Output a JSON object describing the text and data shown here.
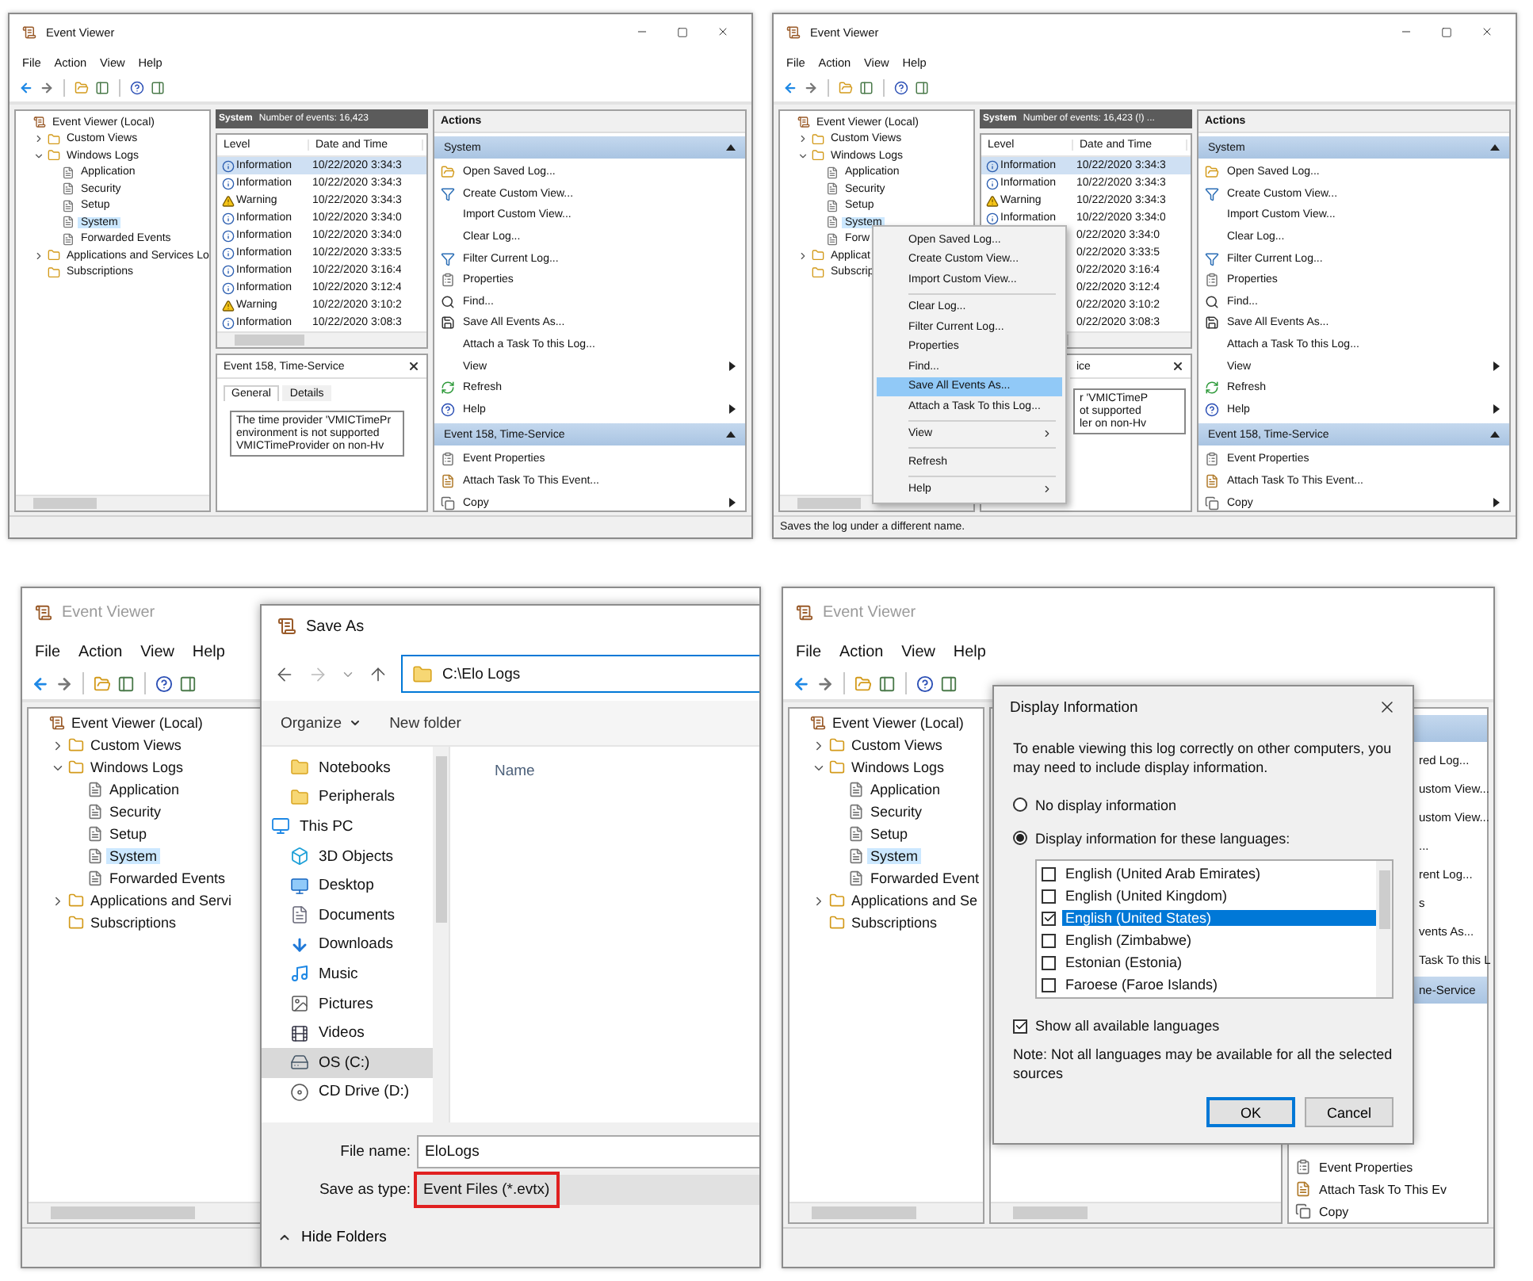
{
  "panels": [
    {
      "kind": "event-viewer",
      "window": {
        "title": "Event Viewer",
        "active": true
      },
      "menu": [
        "File",
        "Action",
        "View",
        "Help"
      ],
      "tree": [
        {
          "label": "Event Viewer (Local)",
          "kind": "root",
          "selected": false,
          "children": [
            {
              "label": "Custom Views",
              "kind": "folder",
              "expanded": false,
              "selected": false
            },
            {
              "label": "Windows Logs",
              "kind": "folder",
              "expanded": true,
              "selected": false,
              "children": [
                {
                  "label": "Application",
                  "kind": "log",
                  "selected": false
                },
                {
                  "label": "Security",
                  "kind": "log",
                  "selected": false
                },
                {
                  "label": "Setup",
                  "kind": "log",
                  "selected": false
                },
                {
                  "label": "System",
                  "kind": "log",
                  "selected": true
                },
                {
                  "label": "Forwarded Events",
                  "kind": "log",
                  "selected": false
                }
              ]
            },
            {
              "label": "Applications and Services Lo",
              "kind": "folder",
              "expanded": false,
              "selected": false
            },
            {
              "label": "Subscriptions",
              "kind": "folder",
              "selected": false
            }
          ]
        }
      ],
      "events_header": {
        "title": "System",
        "info": "Number of events: 16,423"
      },
      "events": {
        "columns": [
          "Level",
          "Date and Time"
        ],
        "rows": [
          {
            "kind": "information",
            "level": "Information",
            "date": "10/22/2020 3:34:3",
            "selected": true
          },
          {
            "kind": "information",
            "level": "Information",
            "date": "10/22/2020 3:34:3",
            "selected": false
          },
          {
            "kind": "warning",
            "level": "Warning",
            "date": "10/22/2020 3:34:3",
            "selected": false
          },
          {
            "kind": "information",
            "level": "Information",
            "date": "10/22/2020 3:34:0",
            "selected": false
          },
          {
            "kind": "information",
            "level": "Information",
            "date": "10/22/2020 3:34:0",
            "selected": false
          },
          {
            "kind": "information",
            "level": "Information",
            "date": "10/22/2020 3:33:5",
            "selected": false
          },
          {
            "kind": "information",
            "level": "Information",
            "date": "10/22/2020 3:16:4",
            "selected": false
          },
          {
            "kind": "information",
            "level": "Information",
            "date": "10/22/2020 3:12:4",
            "selected": false
          },
          {
            "kind": "warning",
            "level": "Warning",
            "date": "10/22/2020 3:10:2",
            "selected": false
          },
          {
            "kind": "information",
            "level": "Information",
            "date": "10/22/2020 3:08:3",
            "selected": false
          }
        ]
      },
      "detail": {
        "title": "Event 158, Time-Service",
        "tabs": [
          {
            "label": "General",
            "selected": true
          },
          {
            "label": "Details",
            "selected": false
          }
        ],
        "lines": [
          "The time provider 'VMICTimePr",
          "environment is not supported",
          "VMICTimeProvider on non-Hv"
        ]
      },
      "actions": {
        "title": "Actions",
        "sections": [
          {
            "title": "System",
            "items": [
              {
                "label": "Open Saved Log...",
                "kind": "open"
              },
              {
                "label": "Create Custom View...",
                "kind": "filter"
              },
              {
                "label": "Import Custom View...",
                "kind": "plain"
              },
              {
                "label": "Clear Log...",
                "kind": "plain"
              },
              {
                "label": "Filter Current Log...",
                "kind": "filter"
              },
              {
                "label": "Properties",
                "kind": "properties"
              },
              {
                "label": "Find...",
                "kind": "find"
              },
              {
                "label": "Save All Events As...",
                "kind": "save"
              },
              {
                "label": "Attach a Task To this Log...",
                "kind": "plain"
              },
              {
                "label": "View",
                "kind": "plain",
                "submenu": true
              },
              {
                "label": "Refresh",
                "kind": "refresh"
              },
              {
                "label": "Help",
                "kind": "help",
                "submenu": true
              }
            ]
          },
          {
            "title": "Event 158, Time-Service",
            "items": [
              {
                "label": "Event Properties",
                "kind": "properties"
              },
              {
                "label": "Attach Task To This Event...",
                "kind": "task"
              },
              {
                "label": "Copy",
                "kind": "copy",
                "submenu": true
              }
            ]
          }
        ]
      }
    },
    {
      "kind": "event-viewer-menu",
      "window": {
        "title": "Event Viewer",
        "active": true
      },
      "menu": [
        "File",
        "Action",
        "View",
        "Help"
      ],
      "tree": [
        {
          "label": "Event Viewer (Local)",
          "kind": "root",
          "selected": false,
          "children": [
            {
              "label": "Custom Views",
              "kind": "folder",
              "expanded": false,
              "selected": false
            },
            {
              "label": "Windows Logs",
              "kind": "folder",
              "expanded": true,
              "selected": false,
              "children": [
                {
                  "label": "Application",
                  "kind": "log",
                  "selected": false
                },
                {
                  "label": "Security",
                  "kind": "log",
                  "selected": false
                },
                {
                  "label": "Setup",
                  "kind": "log",
                  "selected": false
                },
                {
                  "label": "System",
                  "kind": "log",
                  "selected": true
                },
                {
                  "label": "Forw",
                  "kind": "log",
                  "selected": false
                }
              ]
            },
            {
              "label": "Applicat",
              "kind": "folder",
              "expanded": false,
              "selected": false
            },
            {
              "label": "Subscrip",
              "kind": "folder",
              "selected": false
            }
          ]
        }
      ],
      "events_header": {
        "title": "System",
        "info": "Number of events: 16,423 (!) ..."
      },
      "events": {
        "columns": [
          "Level",
          "Date and Time"
        ],
        "rows": [
          {
            "kind": "information",
            "level": "Information",
            "date": "10/22/2020 3:34:3",
            "selected": true
          },
          {
            "kind": "information",
            "level": "Information",
            "date": "10/22/2020 3:34:3",
            "selected": false
          },
          {
            "kind": "warning",
            "level": "Warning",
            "date": "10/22/2020 3:34:3",
            "selected": false
          },
          {
            "kind": "information",
            "level": "Information",
            "date": "10/22/2020 3:34:0",
            "selected": false
          },
          {
            "kind": "covered",
            "date": "0/22/2020 3:34:0",
            "selected": false
          },
          {
            "kind": "covered",
            "date": "0/22/2020 3:33:5",
            "selected": false
          },
          {
            "kind": "covered",
            "date": "0/22/2020 3:16:4",
            "selected": false
          },
          {
            "kind": "covered",
            "date": "0/22/2020 3:12:4",
            "selected": false
          },
          {
            "kind": "covered",
            "date": "0/22/2020 3:10:2",
            "selected": false
          },
          {
            "kind": "covered",
            "date": "0/22/2020 3:08:3",
            "selected": false
          }
        ]
      },
      "detail": {
        "title": "ice",
        "lines": [
          "r 'VMICTimeP",
          "ot supported",
          "ler on non-Hv"
        ]
      },
      "actions": {
        "title": "Actions",
        "sections": [
          {
            "title": "System",
            "items": [
              {
                "label": "Open Saved Log...",
                "kind": "open"
              },
              {
                "label": "Create Custom View...",
                "kind": "filter"
              },
              {
                "label": "Import Custom View...",
                "kind": "plain"
              },
              {
                "label": "Clear Log...",
                "kind": "plain"
              },
              {
                "label": "Filter Current Log...",
                "kind": "filter"
              },
              {
                "label": "Properties",
                "kind": "properties"
              },
              {
                "label": "Find...",
                "kind": "find"
              },
              {
                "label": "Save All Events As...",
                "kind": "save"
              },
              {
                "label": "Attach a Task To this Log...",
                "kind": "plain"
              },
              {
                "label": "View",
                "kind": "plain",
                "submenu": true
              },
              {
                "label": "Refresh",
                "kind": "refresh"
              },
              {
                "label": "Help",
                "kind": "help",
                "submenu": true
              }
            ]
          },
          {
            "title": "Event 158, Time-Service",
            "items": [
              {
                "label": "Event Properties",
                "kind": "properties"
              },
              {
                "label": "Attach Task To This Event...",
                "kind": "task"
              },
              {
                "label": "Copy",
                "kind": "copy",
                "submenu": true
              }
            ]
          }
        ]
      },
      "context_menu": [
        {
          "kind": "item",
          "label": "Open Saved Log...",
          "selected": false
        },
        {
          "kind": "item",
          "label": "Create Custom View...",
          "selected": false
        },
        {
          "kind": "item",
          "label": "Import Custom View...",
          "selected": false
        },
        {
          "kind": "separator"
        },
        {
          "kind": "item",
          "label": "Clear Log...",
          "selected": false
        },
        {
          "kind": "item",
          "label": "Filter Current Log...",
          "selected": false
        },
        {
          "kind": "item",
          "label": "Properties",
          "selected": false
        },
        {
          "kind": "item",
          "label": "Find...",
          "selected": false
        },
        {
          "kind": "item",
          "label": "Save All Events As...",
          "selected": true
        },
        {
          "kind": "item",
          "label": "Attach a Task To this Log...",
          "selected": false
        },
        {
          "kind": "separator"
        },
        {
          "kind": "item",
          "label": "View",
          "selected": false,
          "submenu": true
        },
        {
          "kind": "separator"
        },
        {
          "kind": "item",
          "label": "Refresh",
          "selected": false
        },
        {
          "kind": "separator"
        },
        {
          "kind": "item",
          "label": "Help",
          "selected": false,
          "submenu": true
        }
      ],
      "status": "Saves the log under a different name."
    },
    {
      "kind": "save-as",
      "window": {
        "title": "Event Viewer",
        "active": false
      },
      "menu": [
        "File",
        "Action",
        "View",
        "Help"
      ],
      "tree": [
        {
          "label": "Event Viewer (Local)",
          "kind": "root",
          "selected": false,
          "children": [
            {
              "label": "Custom Views",
              "kind": "folder",
              "expanded": false,
              "selected": false
            },
            {
              "label": "Windows Logs",
              "kind": "folder",
              "expanded": true,
              "selected": false,
              "children": [
                {
                  "label": "Application",
                  "kind": "log",
                  "selected": false
                },
                {
                  "label": "Security",
                  "kind": "log",
                  "selected": false
                },
                {
                  "label": "Setup",
                  "kind": "log",
                  "selected": false
                },
                {
                  "label": "System",
                  "kind": "log",
                  "selected": true
                },
                {
                  "label": "Forwarded Events",
                  "kind": "log",
                  "selected": false
                }
              ]
            },
            {
              "label": "Applications and Servi",
              "kind": "folder",
              "expanded": false,
              "selected": false
            },
            {
              "label": "Subscriptions",
              "kind": "folder",
              "selected": false
            }
          ]
        }
      ],
      "dialog": {
        "title": "Save As",
        "address": "C:\\Elo Logs",
        "toolbar": [
          {
            "label": "Organize",
            "dropdown": true
          },
          {
            "label": "New folder",
            "dropdown": false
          }
        ],
        "nav": [
          {
            "label": "Notebooks",
            "kind": "folder",
            "selected": false
          },
          {
            "label": "Peripherals",
            "kind": "folder",
            "selected": false
          },
          {
            "label": "This PC",
            "kind": "pc",
            "selected": false
          },
          {
            "label": "3D Objects",
            "kind": "objects",
            "selected": false
          },
          {
            "label": "Desktop",
            "kind": "desktop",
            "selected": false
          },
          {
            "label": "Documents",
            "kind": "documents",
            "selected": false
          },
          {
            "label": "Downloads",
            "kind": "downloads",
            "selected": false
          },
          {
            "label": "Music",
            "kind": "music",
            "selected": false
          },
          {
            "label": "Pictures",
            "kind": "pictures",
            "selected": false
          },
          {
            "label": "Videos",
            "kind": "videos",
            "selected": false
          },
          {
            "label": "OS (C:)",
            "kind": "drive",
            "selected": true
          },
          {
            "label": "CD Drive (D:)",
            "kind": "cd",
            "selected": false
          }
        ],
        "columns": [
          "Name"
        ],
        "file_name": {
          "label": "File name:",
          "value": "EloLogs"
        },
        "save_type": {
          "label": "Save as type:",
          "value": "Event Files (*.evtx)",
          "highlighted": true
        },
        "hide_folders": "Hide Folders"
      }
    },
    {
      "kind": "display-info",
      "window": {
        "title": "Event Viewer",
        "active": false
      },
      "menu": [
        "File",
        "Action",
        "View",
        "Help"
      ],
      "tree": [
        {
          "label": "Event Viewer (Local)",
          "kind": "root",
          "selected": false,
          "children": [
            {
              "label": "Custom Views",
              "kind": "folder",
              "expanded": false,
              "selected": false
            },
            {
              "label": "Windows Logs",
              "kind": "folder",
              "expanded": true,
              "selected": false,
              "children": [
                {
                  "label": "Application",
                  "kind": "log",
                  "selected": false
                },
                {
                  "label": "Security",
                  "kind": "log",
                  "selected": false
                },
                {
                  "label": "Setup",
                  "kind": "log",
                  "selected": false
                },
                {
                  "label": "System",
                  "kind": "log",
                  "selected": true
                },
                {
                  "label": "Forwarded Event",
                  "kind": "log",
                  "selected": false
                }
              ]
            },
            {
              "label": "Applications and Se",
              "kind": "folder",
              "expanded": false,
              "selected": false
            },
            {
              "label": "Subscriptions",
              "kind": "folder",
              "selected": false
            }
          ]
        }
      ],
      "actions": [
        {
          "kind": "section"
        },
        {
          "kind": "fragment",
          "label": "red Log..."
        },
        {
          "kind": "fragment",
          "label": "ustom View..."
        },
        {
          "kind": "fragment",
          "label": "ustom View..."
        },
        {
          "kind": "fragment",
          "label": "..."
        },
        {
          "kind": "fragment",
          "label": "rent Log..."
        },
        {
          "kind": "fragment",
          "label": "s"
        },
        {
          "kind": "fragment",
          "label": "vents As..."
        },
        {
          "kind": "fragment",
          "label": "Task To this L"
        },
        {
          "kind": "section",
          "label": "ne-Service"
        },
        {
          "kind": "properties",
          "label": "Event Properties"
        },
        {
          "kind": "task",
          "label": "Attach Task To This Ev"
        },
        {
          "kind": "copy",
          "label": "Copy"
        }
      ],
      "dialog": {
        "title": "Display Information",
        "message": "To enable viewing this log correctly on other computers, you may need to include display information.",
        "options": [
          {
            "label": "No display information",
            "selected": false
          },
          {
            "label": "Display information for these languages:",
            "selected": true
          }
        ],
        "languages": [
          {
            "label": "English (United Arab Emirates)",
            "checked": false,
            "selected": false
          },
          {
            "label": "English (United Kingdom)",
            "checked": false,
            "selected": false
          },
          {
            "label": "English (United States)",
            "checked": true,
            "selected": true
          },
          {
            "label": "English (Zimbabwe)",
            "checked": false,
            "selected": false
          },
          {
            "label": "Estonian (Estonia)",
            "checked": false,
            "selected": false
          },
          {
            "label": "Faroese (Faroe Islands)",
            "checked": false,
            "selected": false
          }
        ],
        "show_all": {
          "label": "Show all available languages",
          "checked": true
        },
        "note": "Note: Not all languages may be available for all the selected sources",
        "buttons": [
          {
            "label": "OK",
            "default": true
          },
          {
            "label": "Cancel",
            "default": false
          }
        ]
      }
    }
  ]
}
